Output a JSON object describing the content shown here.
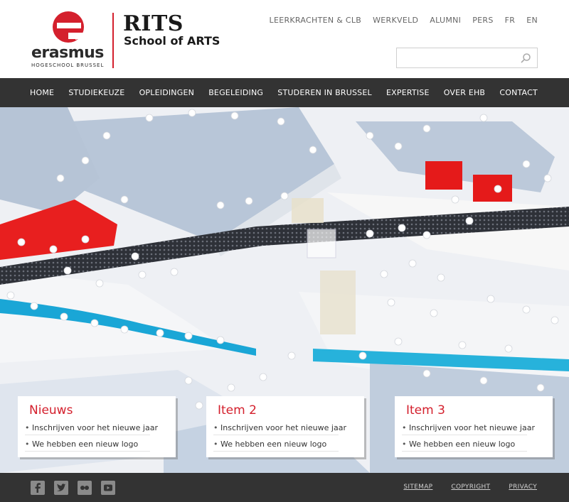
{
  "brand": {
    "logo_word": "erasmus",
    "logo_sub": "HOGESCHOOL BRUSSEL",
    "school_title": "RITS",
    "school_sub": "School of ARTS",
    "accent": "#d4202d"
  },
  "top_links": [
    "LEERKRACHTEN & CLB",
    "WERKVELD",
    "ALUMNI",
    "PERS",
    "FR",
    "EN"
  ],
  "search": {
    "placeholder": "",
    "value": ""
  },
  "nav": [
    "HOME",
    "STUDIEKEUZE",
    "OPLEIDINGEN",
    "BEGELEIDING",
    "STUDEREN IN BRUSSEL",
    "EXPERTISE",
    "OVER EHB",
    "CONTACT"
  ],
  "cards": [
    {
      "title": "Nieuws",
      "items": [
        "Inschrijven voor het nieuwe jaar",
        "We hebben een nieuw logo"
      ]
    },
    {
      "title": "Item 2",
      "items": [
        "Inschrijven voor het nieuwe jaar",
        "We hebben een nieuw logo"
      ]
    },
    {
      "title": "Item 3",
      "items": [
        "Inschrijven voor het nieuwe jaar",
        "We hebben een nieuw logo"
      ]
    }
  ],
  "footer": {
    "social": [
      "facebook-icon",
      "twitter-icon",
      "flickr-icon",
      "youtube-icon"
    ],
    "links": [
      "SITEMAP",
      "COPYRIGHT",
      "PRIVACY"
    ]
  }
}
